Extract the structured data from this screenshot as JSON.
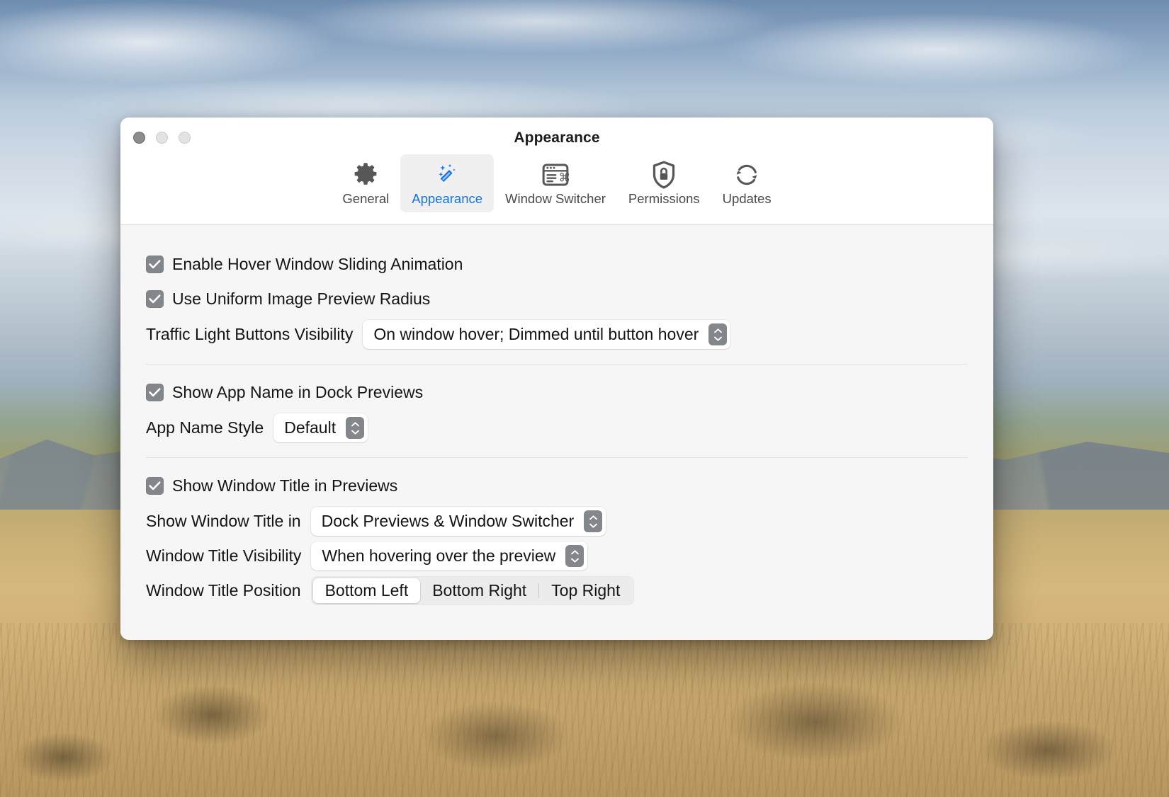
{
  "window": {
    "title": "Appearance",
    "traffic_lights": [
      {
        "name": "close",
        "color": "#8c8c8c"
      },
      {
        "name": "minimize",
        "color": "#e3e3e3"
      },
      {
        "name": "zoom",
        "color": "#e3e3e3"
      }
    ]
  },
  "toolbar": {
    "active_tab": "Appearance",
    "accent_color": "#1273e8",
    "tabs": [
      {
        "label": "General",
        "icon": "gear-icon",
        "active": false
      },
      {
        "label": "Appearance",
        "icon": "magic-wand-icon",
        "active": true
      },
      {
        "label": "Window Switcher",
        "icon": "window-command-icon",
        "active": false
      },
      {
        "label": "Permissions",
        "icon": "shield-lock-icon",
        "active": false
      },
      {
        "label": "Updates",
        "icon": "refresh-circle-icon",
        "active": false
      }
    ]
  },
  "sections": [
    {
      "id": "hover-window",
      "checkboxes": [
        {
          "label": "Enable Hover Window Sliding Animation",
          "checked": true
        },
        {
          "label": "Use Uniform Image Preview Radius",
          "checked": true
        }
      ],
      "popups": [
        {
          "label": "Traffic Light Buttons Visibility",
          "value": "On window hover; Dimmed until button hover"
        }
      ]
    },
    {
      "id": "app-name",
      "checkboxes": [
        {
          "label": "Show App Name in Dock Previews",
          "checked": true
        }
      ],
      "popups": [
        {
          "label": "App Name Style",
          "value": "Default"
        }
      ]
    },
    {
      "id": "window-title",
      "checkboxes": [
        {
          "label": "Show Window Title in Previews",
          "checked": true
        }
      ],
      "popups": [
        {
          "label": "Show Window Title in",
          "value": "Dock Previews & Window Switcher"
        },
        {
          "label": "Window Title Visibility",
          "value": "When hovering over the preview"
        }
      ],
      "segmented": {
        "label": "Window Title Position",
        "selected": "Bottom Left",
        "options": [
          "Bottom Left",
          "Bottom Right",
          "Top Right"
        ]
      }
    }
  ]
}
